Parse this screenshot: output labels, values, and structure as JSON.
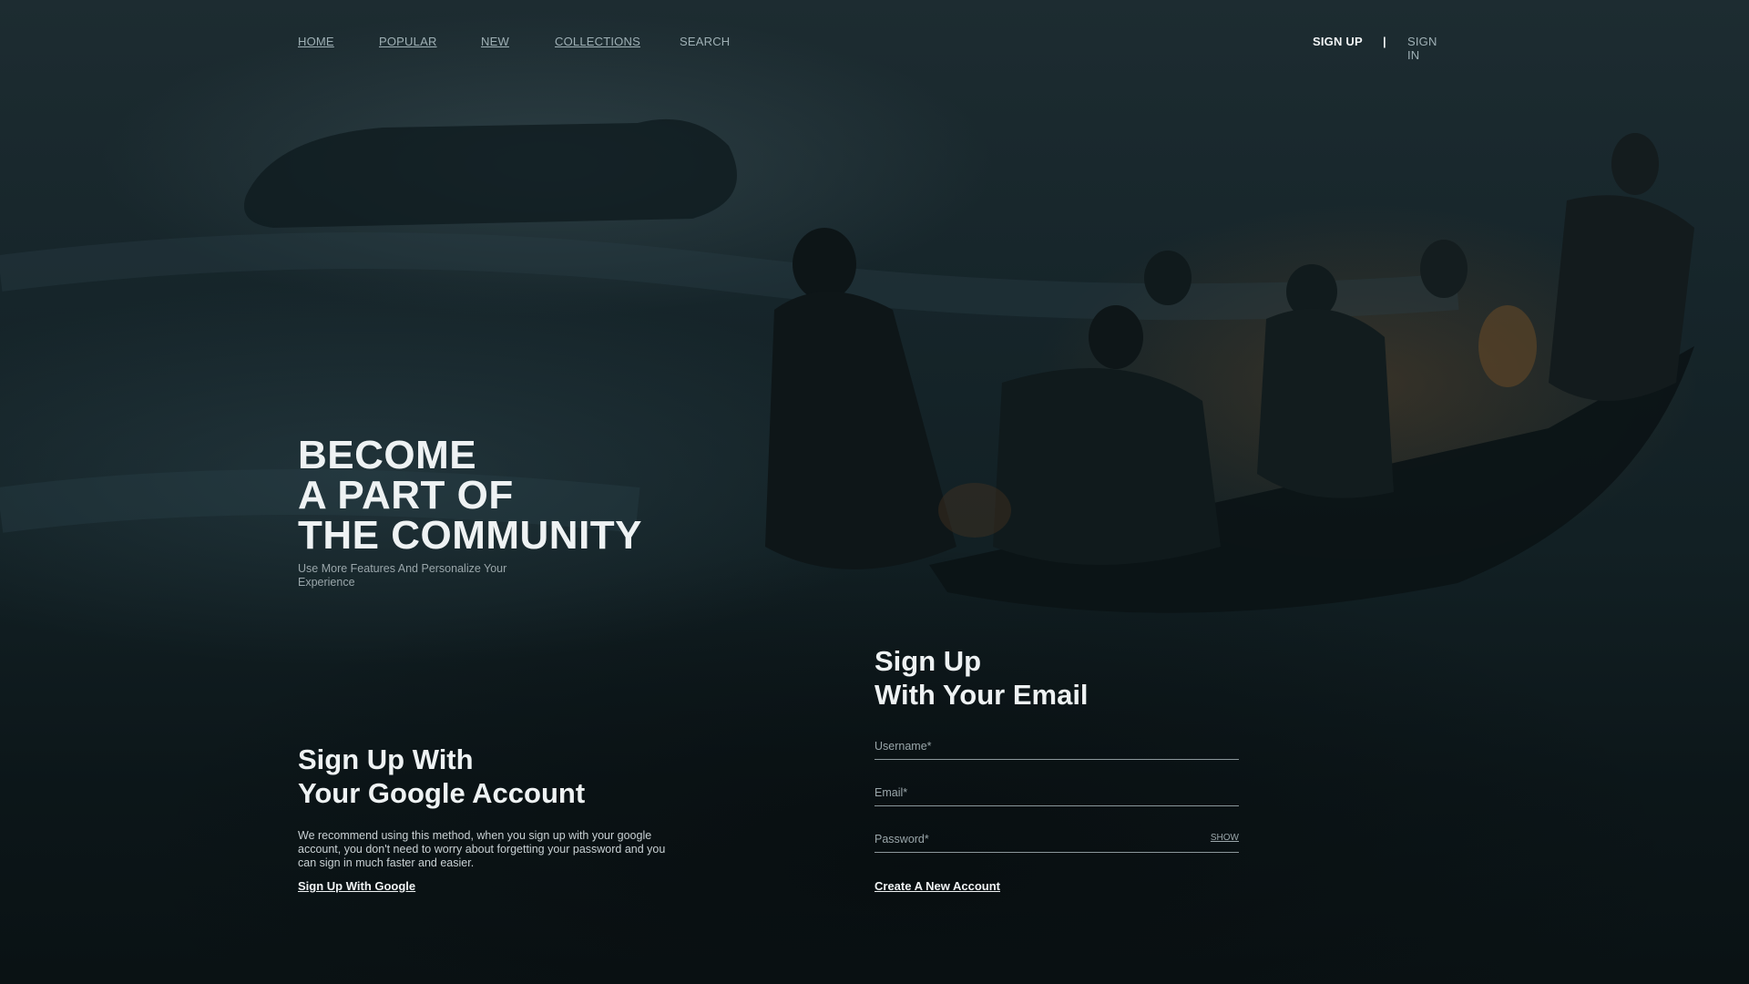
{
  "nav": {
    "items": [
      {
        "label": "HOME"
      },
      {
        "label": "POPULAR"
      },
      {
        "label": "NEW"
      },
      {
        "label": "COLLECTIONS"
      },
      {
        "label": "SEARCH"
      }
    ],
    "signup_label": "SIGN UP",
    "divider": "|",
    "signin_label": "SIGN IN"
  },
  "hero": {
    "title_lines": [
      "BECOME",
      "A PART OF",
      "THE COMMUNITY"
    ],
    "subtitle": "Use More Features And Personalize Your Experience"
  },
  "google": {
    "title_lines": [
      "Sign Up With",
      "Your Google Account"
    ],
    "description": "We recommend using this method, when you sign up with your google account, you don't need to worry about forgetting your password and you can sign in much faster and easier.",
    "link_label": "Sign Up With Google"
  },
  "email_form": {
    "title_lines": [
      "Sign Up",
      "With Your Email"
    ],
    "username": {
      "placeholder": "Username*",
      "value": ""
    },
    "email": {
      "placeholder": "Email*",
      "value": ""
    },
    "password": {
      "placeholder": "Password*",
      "value": "",
      "toggle_label": "SHOW"
    },
    "submit_label": "Create A New Account"
  },
  "colors": {
    "background": "#0a1214",
    "text_primary": "#eef2f3",
    "text_muted": "#9aa6aa"
  }
}
